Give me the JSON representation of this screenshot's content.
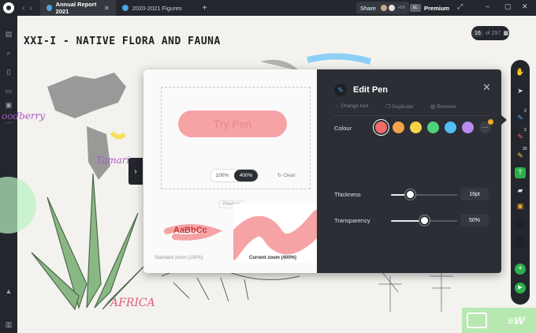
{
  "topbar": {
    "tabs": [
      {
        "label": "Annual Report 2021",
        "active": true
      },
      {
        "label": "2020-2021 Figures",
        "active": false
      }
    ],
    "share_label": "Share",
    "collab_count": "+59",
    "plan_badge": "EL",
    "premium_label": "Premium"
  },
  "canvas": {
    "title": "XXI-I - NATIVE FLORA AND FAUNA",
    "pager_current": "16",
    "pager_total": "of 297",
    "labels": {
      "berry": "oodberry",
      "tamarind": "Tamarin",
      "africa": "AFRICA"
    }
  },
  "modal": {
    "title": "Edit Pen",
    "actions": [
      "Change tool",
      "Duplicate",
      "Remove"
    ],
    "preview": {
      "pen_text": "Try Pen",
      "zoom_options": [
        "100%",
        "400%"
      ],
      "zoom_selected": "400%",
      "clear_label": "Clear",
      "preview_label": "Preview",
      "sample_text": "AaBbCc",
      "caption_standard": "Standard zoom (100%)",
      "caption_current": "Current zoom (400%)"
    },
    "colour_label": "Colour",
    "colours": [
      "#f26b6b",
      "#f5a34a",
      "#f5d547",
      "#4fd27a",
      "#4fbff5",
      "#b98af0"
    ],
    "selected_colour": "#f26b6b",
    "thickness_label": "Thickness",
    "thickness_value": "16pt",
    "thickness_level": 0.28,
    "transparency_label": "Transparency",
    "transparency_value": "50%",
    "transparency_level": 0.5
  },
  "right_toolbar": {
    "tools": [
      "hand-tool",
      "select-tool",
      "pen-tool",
      "highlighter-tool",
      "pencil-tool",
      "text-tool",
      "eraser-tool",
      "sticky-tool"
    ],
    "badges": [
      "2",
      "2",
      "20"
    ]
  }
}
